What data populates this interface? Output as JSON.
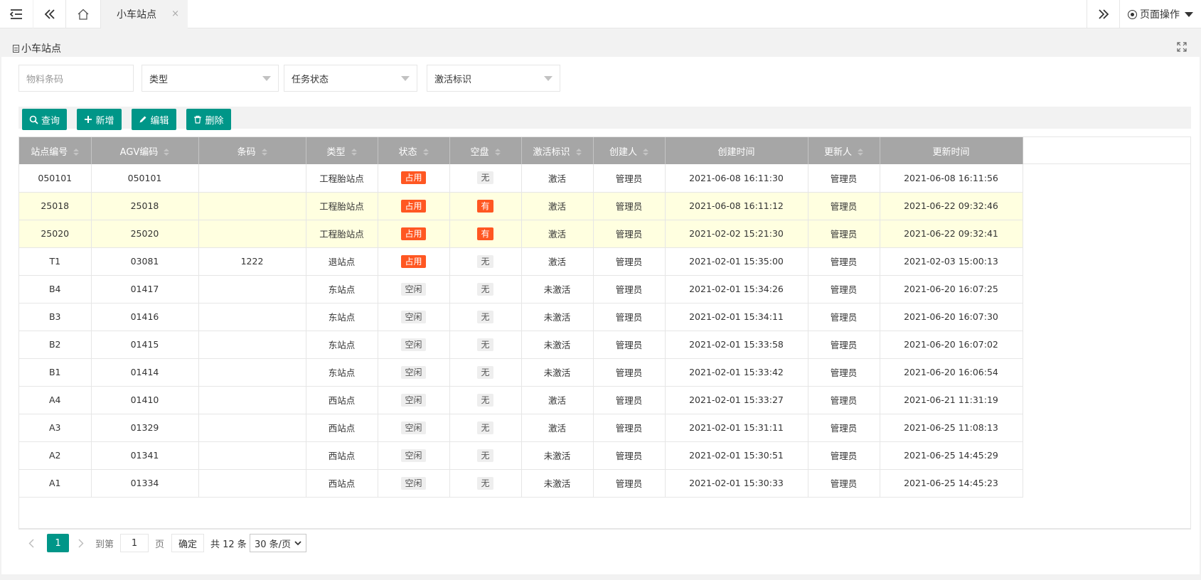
{
  "topbar": {
    "tab_label": "小车站点",
    "tab_close": "×",
    "page_ops_label": "页面操作"
  },
  "page": {
    "title": "小车站点"
  },
  "filters": {
    "barcode_placeholder": "物料条码",
    "type_label": "类型",
    "task_status_label": "任务状态",
    "activation_label": "激活标识"
  },
  "toolbar": {
    "query_label": "查询",
    "add_label": "新增",
    "edit_label": "编辑",
    "delete_label": "删除"
  },
  "table": {
    "columns": [
      "站点编号",
      "AGV编码",
      "条码",
      "类型",
      "状态",
      "空盘",
      "激活标识",
      "创建人",
      "创建时间",
      "更新人",
      "更新时间"
    ],
    "rows": [
      {
        "station": "050101",
        "agv": "050101",
        "barcode": "",
        "type": "工程胎站点",
        "status": "占用",
        "empty": "无",
        "active": "激活",
        "creator": "管理员",
        "created": "2021-06-08 16:11:30",
        "updater": "管理员",
        "updated": "2021-06-08 16:11:56",
        "highlight": false
      },
      {
        "station": "25018",
        "agv": "25018",
        "barcode": "",
        "type": "工程胎站点",
        "status": "占用",
        "empty": "有",
        "active": "激活",
        "creator": "管理员",
        "created": "2021-06-08 16:11:12",
        "updater": "管理员",
        "updated": "2021-06-22 09:32:46",
        "highlight": true
      },
      {
        "station": "25020",
        "agv": "25020",
        "barcode": "",
        "type": "工程胎站点",
        "status": "占用",
        "empty": "有",
        "active": "激活",
        "creator": "管理员",
        "created": "2021-02-02 15:21:30",
        "updater": "管理员",
        "updated": "2021-06-22 09:32:41",
        "highlight": true
      },
      {
        "station": "T1",
        "agv": "03081",
        "barcode": "1222",
        "type": "退站点",
        "status": "占用",
        "empty": "无",
        "active": "激活",
        "creator": "管理员",
        "created": "2021-02-01 15:35:00",
        "updater": "管理员",
        "updated": "2021-02-03 15:00:13",
        "highlight": false
      },
      {
        "station": "B4",
        "agv": "01417",
        "barcode": "",
        "type": "东站点",
        "status": "空闲",
        "empty": "无",
        "active": "未激活",
        "creator": "管理员",
        "created": "2021-02-01 15:34:26",
        "updater": "管理员",
        "updated": "2021-06-20 16:07:25",
        "highlight": false
      },
      {
        "station": "B3",
        "agv": "01416",
        "barcode": "",
        "type": "东站点",
        "status": "空闲",
        "empty": "无",
        "active": "未激活",
        "creator": "管理员",
        "created": "2021-02-01 15:34:11",
        "updater": "管理员",
        "updated": "2021-06-20 16:07:30",
        "highlight": false
      },
      {
        "station": "B2",
        "agv": "01415",
        "barcode": "",
        "type": "东站点",
        "status": "空闲",
        "empty": "无",
        "active": "未激活",
        "creator": "管理员",
        "created": "2021-02-01 15:33:58",
        "updater": "管理员",
        "updated": "2021-06-20 16:07:02",
        "highlight": false
      },
      {
        "station": "B1",
        "agv": "01414",
        "barcode": "",
        "type": "东站点",
        "status": "空闲",
        "empty": "无",
        "active": "未激活",
        "creator": "管理员",
        "created": "2021-02-01 15:33:42",
        "updater": "管理员",
        "updated": "2021-06-20 16:06:54",
        "highlight": false
      },
      {
        "station": "A4",
        "agv": "01410",
        "barcode": "",
        "type": "西站点",
        "status": "空闲",
        "empty": "无",
        "active": "激活",
        "creator": "管理员",
        "created": "2021-02-01 15:33:27",
        "updater": "管理员",
        "updated": "2021-06-21 11:31:19",
        "highlight": false
      },
      {
        "station": "A3",
        "agv": "01329",
        "barcode": "",
        "type": "西站点",
        "status": "空闲",
        "empty": "无",
        "active": "激活",
        "creator": "管理员",
        "created": "2021-02-01 15:31:11",
        "updater": "管理员",
        "updated": "2021-06-25 11:08:13",
        "highlight": false
      },
      {
        "station": "A2",
        "agv": "01341",
        "barcode": "",
        "type": "西站点",
        "status": "空闲",
        "empty": "无",
        "active": "未激活",
        "creator": "管理员",
        "created": "2021-02-01 15:30:51",
        "updater": "管理员",
        "updated": "2021-06-25 14:45:29",
        "highlight": false
      },
      {
        "station": "A1",
        "agv": "01334",
        "barcode": "",
        "type": "西站点",
        "status": "空闲",
        "empty": "无",
        "active": "未激活",
        "creator": "管理员",
        "created": "2021-02-01 15:30:33",
        "updater": "管理员",
        "updated": "2021-06-25 14:45:23",
        "highlight": false
      }
    ]
  },
  "pager": {
    "current_page": "1",
    "goto_label": "到第",
    "page_input": "1",
    "page_suffix": "页",
    "confirm_label": "确定",
    "total_label": "共 12 条",
    "page_size": "30 条/页"
  },
  "colors": {
    "primary": "#009688",
    "danger_badge": "#ff5722",
    "header_bg": "#a6a6a6",
    "highlight_row": "#ffffe0"
  }
}
